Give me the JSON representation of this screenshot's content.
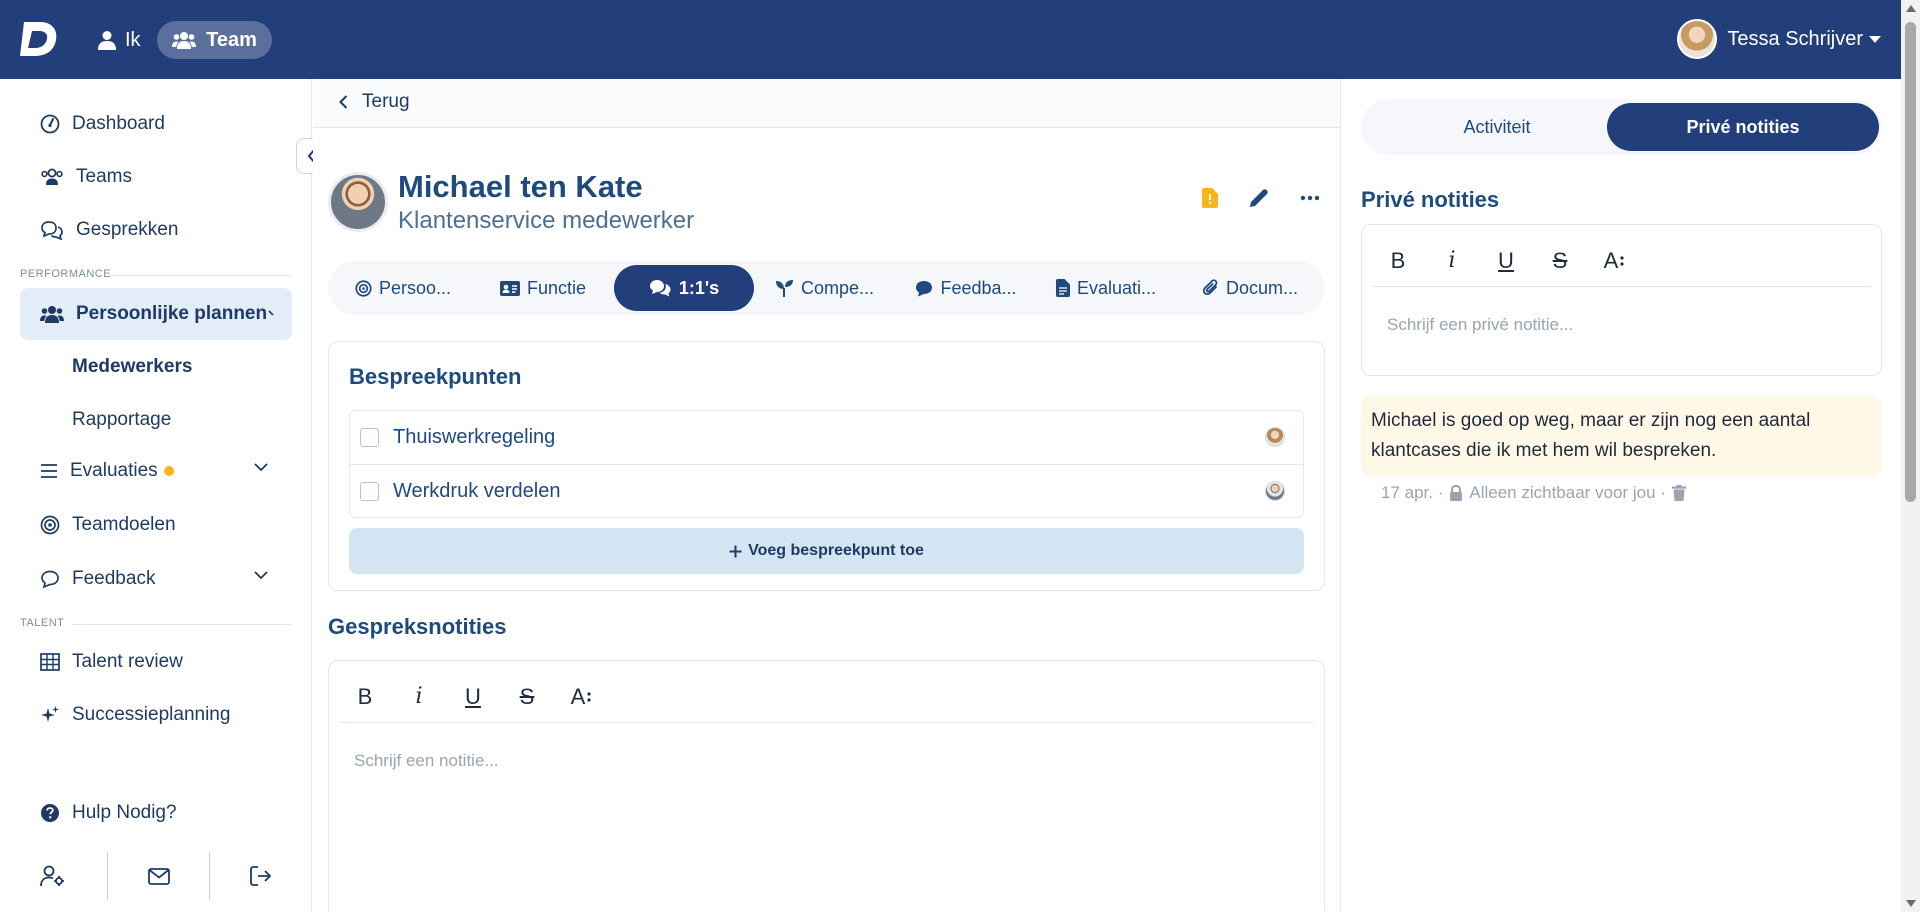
{
  "topbar": {
    "logo_letter": "D",
    "nav_ik": "Ik",
    "nav_team": "Team",
    "user_name": "Tessa Schrijver"
  },
  "sidebar": {
    "items": [
      {
        "label": "Dashboard",
        "icon": "gauge-icon"
      },
      {
        "label": "Teams",
        "icon": "users-icon"
      },
      {
        "label": "Gesprekken",
        "icon": "chat-bubbles-icon"
      }
    ],
    "section_performance": "PERFORMANCE",
    "active_item": "Persoonlijke plannen",
    "sub_items": [
      "Medewerkers",
      "Rapportage"
    ],
    "evaluaties": "Evaluaties",
    "teamdoelen": "Teamdoelen",
    "feedback": "Feedback",
    "section_talent": "TALENT",
    "talent_review": "Talent review",
    "successieplanning": "Successieplanning",
    "help": "Hulp Nodig?",
    "colors": {
      "accent": "#233f7b",
      "active_bg": "#e2edf8",
      "badge": "#f5b51b"
    }
  },
  "main": {
    "back_label": "Terug",
    "profile": {
      "name": "Michael ten Kate",
      "role": "Klantenservice medewerker"
    },
    "tabs": [
      {
        "label": "Persoo...",
        "icon": "target-icon"
      },
      {
        "label": "Functie",
        "icon": "id-card-icon"
      },
      {
        "label": "1:1's",
        "icon": "comments-icon"
      },
      {
        "label": "Compe...",
        "icon": "seedling-icon"
      },
      {
        "label": "Feedba...",
        "icon": "comment-icon"
      },
      {
        "label": "Evaluati...",
        "icon": "file-icon"
      },
      {
        "label": "Docum...",
        "icon": "paperclip-icon"
      }
    ],
    "agenda": {
      "title": "Bespreekpunten",
      "items": [
        {
          "label": "Thuiswerkregeling"
        },
        {
          "label": "Werkdruk verdelen"
        }
      ],
      "add_label": "Voeg bespreekpunt toe"
    },
    "notes": {
      "title": "Gespreksnotities",
      "placeholder": "Schrijf een notitie..."
    }
  },
  "editor_toolbar": {
    "bold": "B",
    "italic": "i",
    "underline": "U",
    "strike": "S",
    "size": "A"
  },
  "right_panel": {
    "tabs": [
      "Activiteit",
      "Privé notities"
    ],
    "title": "Privé notities",
    "placeholder": "Schrijf een privé notitie...",
    "note_text": "Michael is goed op weg, maar er zijn nog een aantal klantcases die ik met hem wil bespreken.",
    "note_date": "17 apr. ·",
    "note_visibility": "Alleen zichtbaar voor jou ·"
  }
}
